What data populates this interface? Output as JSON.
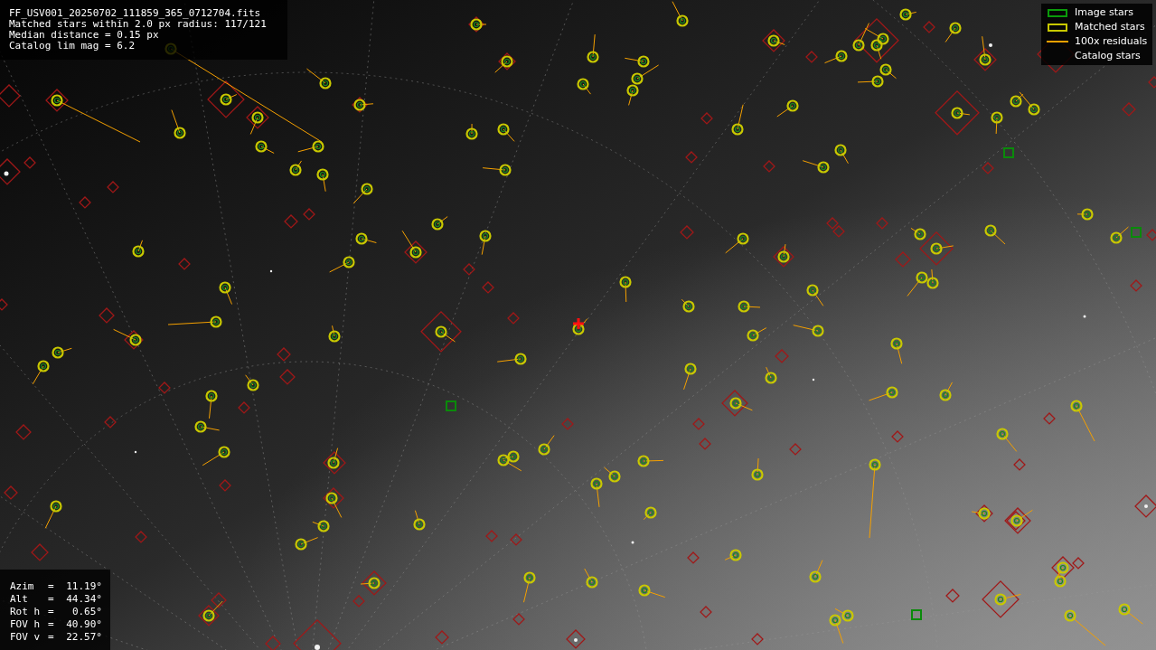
{
  "info": {
    "lines": [
      "FF_USV001_20250702_111859_365_0712704.fits",
      "Matched stars within 2.0 px radius: 117/121",
      "Median distance = 0.15 px",
      "Catalog lim mag = 6.2"
    ]
  },
  "legend": [
    {
      "kind": "image",
      "label": "Image stars"
    },
    {
      "kind": "matched",
      "label": "Matched stars"
    },
    {
      "kind": "residual",
      "label": "100x residuals"
    },
    {
      "kind": "catalog",
      "label": "Catalog stars"
    }
  ],
  "pointing": [
    {
      "label": "Azim",
      "sign": "=",
      "value": "11.19°"
    },
    {
      "label": "Alt",
      "sign": "=",
      "value": "44.34°"
    },
    {
      "label": "Rot h",
      "sign": "=",
      "value": "0.65°"
    },
    {
      "label": "FOV h",
      "sign": "=",
      "value": "40.90°"
    },
    {
      "label": "FOV v",
      "sign": "=",
      "value": "22.57°"
    }
  ]
}
